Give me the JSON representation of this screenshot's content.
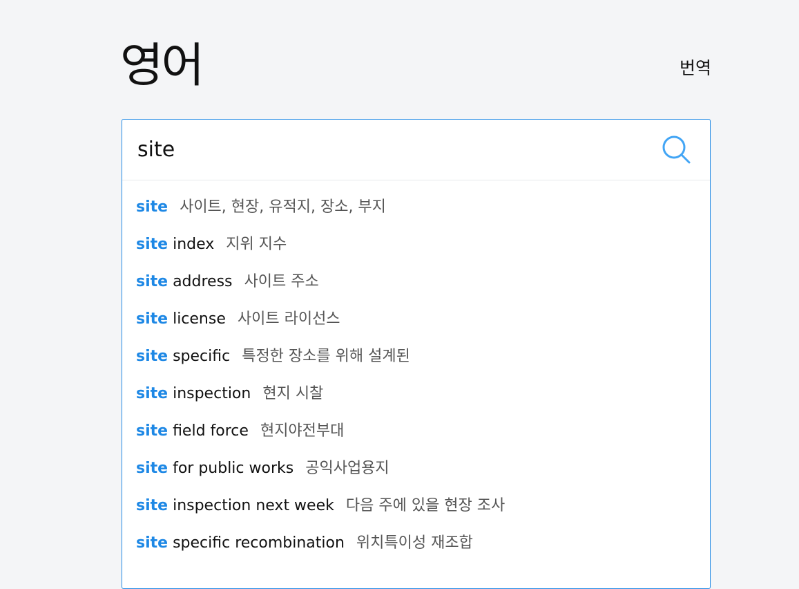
{
  "header": {
    "logo": "영어",
    "translate_label": "번역"
  },
  "search": {
    "value": "site",
    "placeholder": ""
  },
  "accent_color": "#1e88e5",
  "suggestions": [
    {
      "keyword": "site",
      "rest": "",
      "meaning": "사이트, 현장, 유적지, 장소, 부지"
    },
    {
      "keyword": "site",
      "rest": "index",
      "meaning": "지위 지수"
    },
    {
      "keyword": "site",
      "rest": "address",
      "meaning": "사이트 주소"
    },
    {
      "keyword": "site",
      "rest": "license",
      "meaning": "사이트 라이선스"
    },
    {
      "keyword": "site",
      "rest": "specific",
      "meaning": "특정한 장소를 위해 설계된"
    },
    {
      "keyword": "site",
      "rest": "inspection",
      "meaning": "현지 시찰"
    },
    {
      "keyword": "site",
      "rest": "field force",
      "meaning": "현지야전부대"
    },
    {
      "keyword": "site",
      "rest": "for public works",
      "meaning": "공익사업용지"
    },
    {
      "keyword": "site",
      "rest": "inspection next week",
      "meaning": "다음 주에 있을 현장 조사"
    },
    {
      "keyword": "site",
      "rest": "specific recombination",
      "meaning": "위치특이성 재조합"
    }
  ]
}
